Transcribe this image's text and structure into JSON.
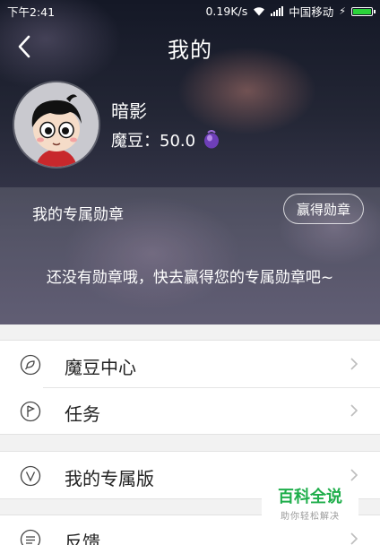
{
  "status_bar": {
    "time": "下午2:41",
    "speed": "0.19K/s",
    "carrier": "中国移动",
    "battery_color": "#2bd43a"
  },
  "header": {
    "title": "我的",
    "back_icon": "back-arrow-icon"
  },
  "profile": {
    "name": "暗影",
    "modou_label": "魔豆：50.0",
    "gem_icon": "purple-gem-icon"
  },
  "medals": {
    "title": "我的专属勋章",
    "earn_button": "赢得勋章",
    "empty_text": "还没有勋章哦，快去赢得您的专属勋章吧~"
  },
  "menu": {
    "groups": [
      {
        "items": [
          {
            "label": "魔豆中心",
            "icon": "leaf-circle-icon"
          },
          {
            "label": "任务",
            "icon": "flag-circle-icon"
          }
        ]
      },
      {
        "items": [
          {
            "label": "我的专属版",
            "icon": "v-circle-icon"
          }
        ]
      },
      {
        "items": [
          {
            "label": "反馈",
            "icon": "message-circle-icon"
          }
        ]
      }
    ]
  },
  "watermark": {
    "main": "百科全说",
    "sub": "助你轻松解决"
  },
  "colors": {
    "watermark_green": "#1fae4b",
    "menu_text": "#222222"
  }
}
